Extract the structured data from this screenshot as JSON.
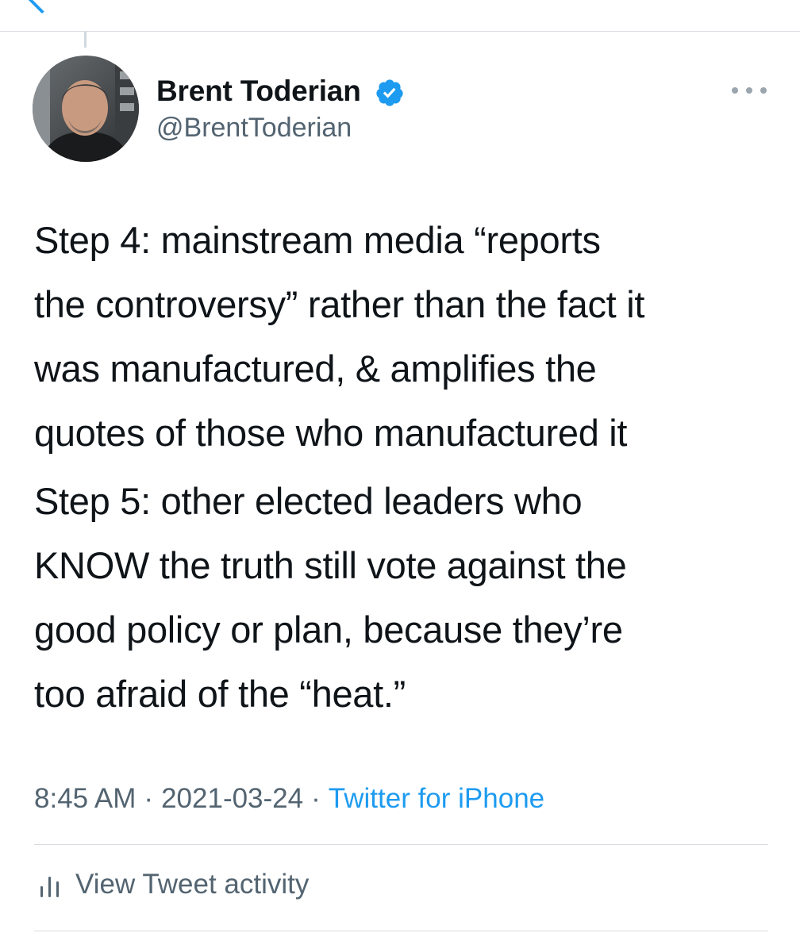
{
  "header": {
    "back_icon": "back-chevron-icon"
  },
  "author": {
    "display_name": "Brent Toderian",
    "handle": "@BrentToderian",
    "verified": true,
    "verified_icon": "verified-badge-icon",
    "avatar": "profile-photo"
  },
  "more_icon": "more-dots-icon",
  "tweet": {
    "paragraphs": [
      "Step 4: mainstream media “reports\nthe controversy” rather than the fact it\nwas manufactured, & amplifies the\nquotes of those who manufactured it",
      "Step 5: other elected leaders who\nKNOW the truth still vote against the\ngood policy or plan, because they’re\ntoo afraid of the “heat.”"
    ]
  },
  "meta": {
    "time": "8:45 AM",
    "separator": "·",
    "date": "2021-03-24",
    "source": "Twitter for iPhone"
  },
  "activity": {
    "icon": "bar-chart-icon",
    "label": "View Tweet activity"
  },
  "colors": {
    "accent": "#1d9bf0",
    "text_primary": "#0f1419",
    "text_secondary": "#536471",
    "divider": "#d9dde1"
  }
}
